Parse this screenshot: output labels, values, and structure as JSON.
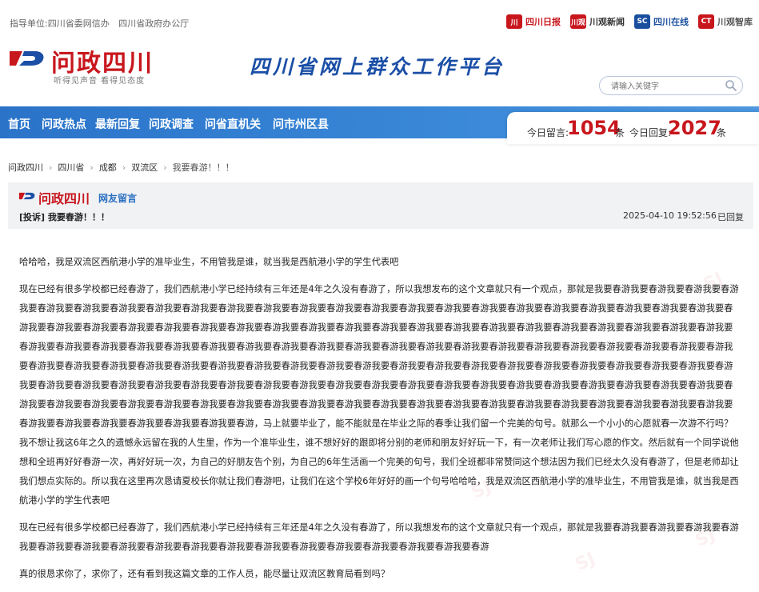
{
  "header": {
    "guide_label": "指导单位:四川省委网信办",
    "guide_org2": "四川省政府办公厅",
    "partners": [
      {
        "name": "四川日报",
        "badge": "川"
      },
      {
        "name": "川观新闻",
        "badge": "川观"
      },
      {
        "name": "四川在线",
        "badge": "SC"
      },
      {
        "name": "川观智库",
        "badge": "CT"
      }
    ],
    "logo_text": "问政四川",
    "logo_tagline": "听得见声音 看得见态度",
    "slogan": "四川省网上群众工作平台",
    "search_placeholder": "请输入关键字"
  },
  "nav": {
    "items": [
      "首页",
      "问政热点",
      "最新回复",
      "问政调查",
      "问省直机关",
      "问市州区县"
    ]
  },
  "stats": {
    "today_msg_label": "今日留言:",
    "today_msg_count": "1054",
    "today_reply_label": "今日回复:",
    "today_reply_count": "2027",
    "unit": "条"
  },
  "breadcrumb": {
    "items": [
      "问政四川",
      "四川省",
      "成都",
      "双流区"
    ],
    "current": "我要春游！！！"
  },
  "message": {
    "brand": "问政四川",
    "category": "网友留言",
    "title": "[投诉] 我要春游！！！",
    "date": "2025-04-10 19:52:56",
    "status": "已回复",
    "paragraphs": [
      "哈哈哈，我是双流区西航港小学的准毕业生，不用管我是谁，就当我是西航港小学的学生代表吧",
      "现在已经有很多学校都已经春游了，我们西航港小学已经持续有三年还是4年之久没有春游了，所以我想发布的这个文章就只有一个观点，那就是我要春游我要春游我要春游我要春游我要春游我要春游我要春游我要春游我要春游我要春游我要春游我要春游我要春游我要春游我要春游我要春游我要春游我要春游我要春游我要春游我要春游我要春游我要春游我要春游我要春游我要春游我要春游我要春游我要春游我要春游我要春游我要春游我要春游我要春游我要春游我要春游我要春游我要春游我要春游我要春游我要春游我要春游我要春游我要春游我要春游我要春游我要春游我要春游我要春游我要春游我要春游我要春游我要春游我要春游我要春游我要春游我要春游我要春游我要春游我要春游我要春游我要春游我要春游我要春游我要春游我要春游我要春游我要春游我要春游我要春游我要春游我要春游我要春游我要春游我要春游我要春游我要春游我要春游我要春游我要春游我要春游我要春游我要春游我要春游我要春游我要春游我要春游我要春游我要春游我要春游我要春游我要春游我要春游我要春游我要春游我要春游我要春游我要春游我要春游我要春游我要春游我要春游我要春游我要春游我要春游我要春游我要春游我要春游我要春游我要春游我要春游我要春游我要春游我要春游我要春游我要春游我要春游我要春游我要春游我要春游我要春游我要春游我要春游我要春游我要春游我要春游我要春游我要春游我要春游，马上就要毕业了，能不能就是在毕业之际的春季让我们留一个完美的句号。就那么一个小小的心愿就春一次游不行吗？我不想让我这6年之久的遗憾永远留在我的人生里，作为一个准毕业生，谁不想好好的跟即将分别的老师和朋友好好玩一下，有一次老师让我们写心愿的作文。然后就有一个同学说他想和全班再好好春游一次，再好好玩一次，为自己的好朋友告个别，为自己的6年生活画一个完美的句号，我们全班都非常赞同这个想法因为我们已经太久没有春游了，但是老师却让我们想点实际的。所以我在这里再次恳请夏校长你就让我们春游吧，让我们在这个学校6年好好的画一个句号哈哈哈，我是双流区西航港小学的准毕业生，不用管我是谁，就当我是西航港小学的学生代表吧",
      "现在已经有很多学校都已经春游了，我们西航港小学已经持续有三年还是4年之久没有春游了，所以我想发布的这个文章就只有一个观点，那就是我要春游我要春游我要春游我要春游我要春游我要春游我要春游我要春游我要春游我要春游我要春游我要春游我要春游我要春游我要春游我要春游我要春游",
      "真的很恳求你了，求你了，还有看到我这篇文章的工作人员，能尽量让双流区教育局看到吗？"
    ]
  },
  "colors": {
    "brand_red": "#c8161d",
    "nav_blue": "#2a73c9",
    "slogan_blue": "#1b4fa6"
  }
}
